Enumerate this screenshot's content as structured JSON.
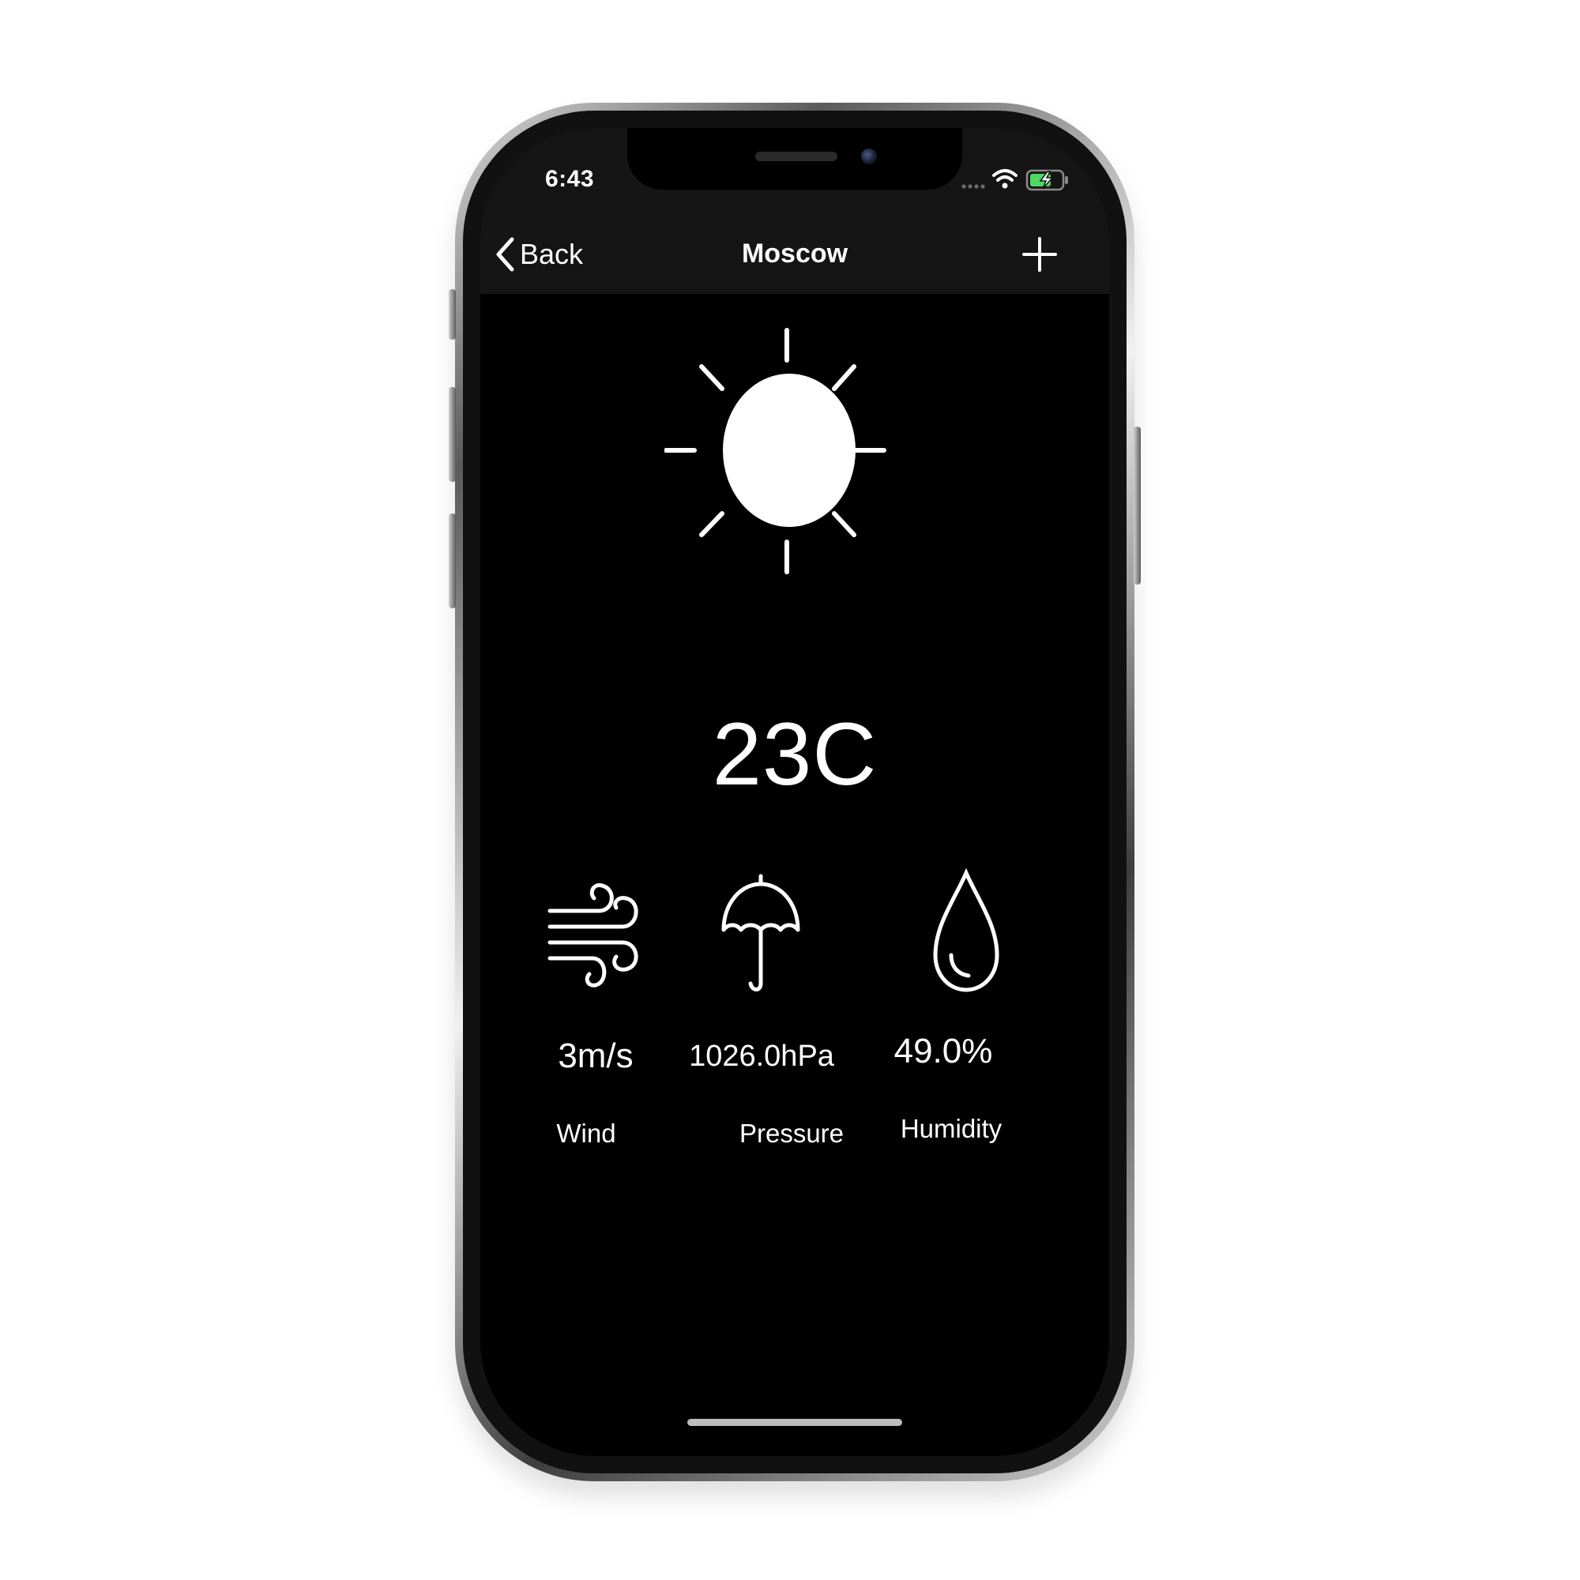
{
  "status_bar": {
    "time": "6:43",
    "icons": [
      "signal-dots-icon",
      "wifi-icon",
      "battery-charging-icon"
    ]
  },
  "nav": {
    "back_label": "Back",
    "title": "Moscow",
    "back_icon": "chevron-left-icon",
    "add_icon": "plus-icon"
  },
  "weather": {
    "condition_icon": "sun-icon",
    "temperature": "23C",
    "metrics": [
      {
        "icon": "wind-icon",
        "value": "3m/s",
        "label": "Wind"
      },
      {
        "icon": "umbrella-icon",
        "value": "1026.0hPa",
        "label": "Pressure"
      },
      {
        "icon": "water-drop-icon",
        "value": "49.0%",
        "label": "Humidity"
      }
    ]
  },
  "colors": {
    "screen_background": "#000000",
    "bar_background": "#151515",
    "text": "#ffffff",
    "battery_charge": "#4cd964"
  }
}
